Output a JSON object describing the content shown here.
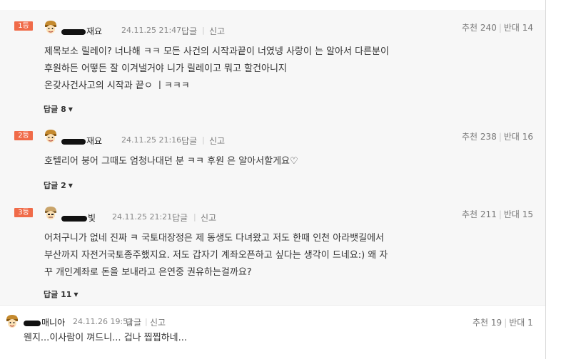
{
  "comments": [
    {
      "rank": "1등",
      "nickname": "재요",
      "date": "24.11.25 21:47",
      "reply_label": "답글",
      "report_label": "신고",
      "up_label": "추천",
      "up": "240",
      "down_label": "반대",
      "down": "14",
      "lines": [
        "제목보소 릴레이? 너나해 ㅋㅋ 모든 사건의 시작과끝이 너였넹 사랑이 는 알아서 다른분이",
        "후원하든 어떻든 잘 이겨낼거야 니가 릴레이고 뭐고 할건아니지",
        "온갖사건사고의 시작과 끝ㅇ ㅣㅋㅋㅋ"
      ],
      "replies": "답글 8"
    },
    {
      "rank": "2등",
      "nickname": "재요",
      "date": "24.11.25 21:16",
      "reply_label": "답글",
      "report_label": "신고",
      "up_label": "추천",
      "up": "238",
      "down_label": "반대",
      "down": "16",
      "lines": [
        "호텔리어 붕어 그때도 엄청나대던 분 ㅋㅋ 후원 은 알아서할게요♡"
      ],
      "replies": "답글 2"
    },
    {
      "rank": "3등",
      "nickname": "빛",
      "date": "24.11.25 21:21",
      "reply_label": "답글",
      "report_label": "신고",
      "up_label": "추천",
      "up": "211",
      "down_label": "반대",
      "down": "15",
      "lines": [
        "어처구니가 없네 진짜 ㅋ 국토대장정은 제 동생도 다녀왔고 저도 한때 인천 아라뱃길에서",
        "부산까지 자전거국토종주했지요. 저도 갑자기 계좌오픈하고 싶다는 생각이 드네요:) 왜 자",
        "꾸 개인계좌로 돈을 보내라고 은연중 권유하는걸까요?"
      ],
      "replies": "답글 11"
    }
  ],
  "last_comment": {
    "nickname": "매니아",
    "date": "24.11.26 19:51",
    "reply_label": "답글",
    "report_label": "신고",
    "up_label": "추천",
    "up": "19",
    "down_label": "반대",
    "down": "1",
    "text": "웬지...이사람이 껴드니... 겁나 찝찝하네..."
  },
  "colors": {
    "rank_badge": "#f06b49",
    "best_background": "#f7f7f7"
  },
  "icons": {
    "avatar": "helmet-face-icon",
    "caret": "caret-down-icon"
  }
}
